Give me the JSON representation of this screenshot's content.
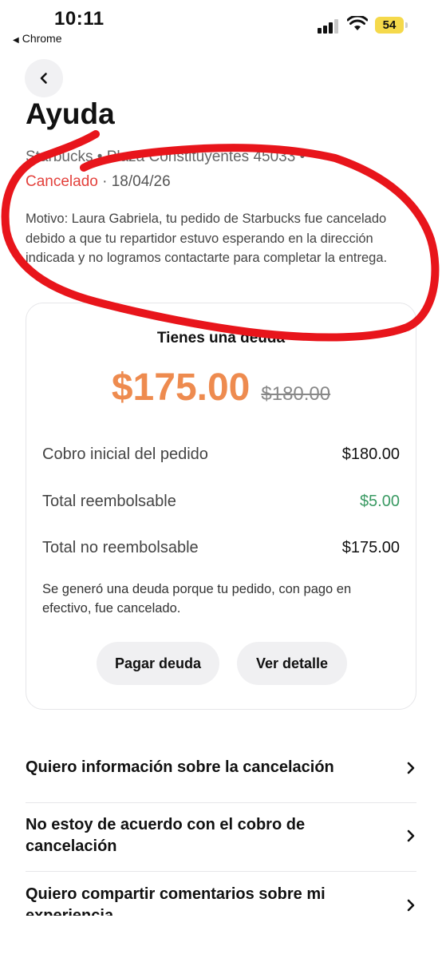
{
  "status_bar": {
    "time": "10:11",
    "back_app": "Chrome",
    "battery": "54"
  },
  "header": {
    "title": "Ayuda"
  },
  "order": {
    "store": "Starbucks • Plaza Constituyentes 45033 •",
    "status": "Cancelado",
    "date": "18/04/26",
    "reason": "Motivo: Laura Gabriela, tu pedido de Starbucks fue cancelado debido a que tu repartidor estuvo esperando en la dirección indicada y no logramos contactarte para completar la entrega."
  },
  "debt_card": {
    "title": "Tienes una deuda",
    "amount": "$175.00",
    "original_amount": "$180.00",
    "rows": [
      {
        "label": "Cobro inicial del pedido",
        "value": "$180.00"
      },
      {
        "label": "Total reembolsable",
        "value": "$5.00"
      },
      {
        "label": "Total no reembolsable",
        "value": "$175.00"
      }
    ],
    "note": "Se generó una deuda porque tu pedido, con pago en efectivo, fue cancelado.",
    "pay_button": "Pagar deuda",
    "detail_button": "Ver detalle"
  },
  "help_options": [
    {
      "label": "Quiero información sobre la cancelación"
    },
    {
      "label": "No estoy de acuerdo con el cobro de cancelación"
    },
    {
      "label": "Quiero compartir comentarios sobre mi experiencia"
    }
  ],
  "colors": {
    "accent_orange": "#ee8b4f",
    "cancelled_red": "#e3413c",
    "refund_green": "#3a9a63",
    "annotation_red": "#e8151b"
  }
}
